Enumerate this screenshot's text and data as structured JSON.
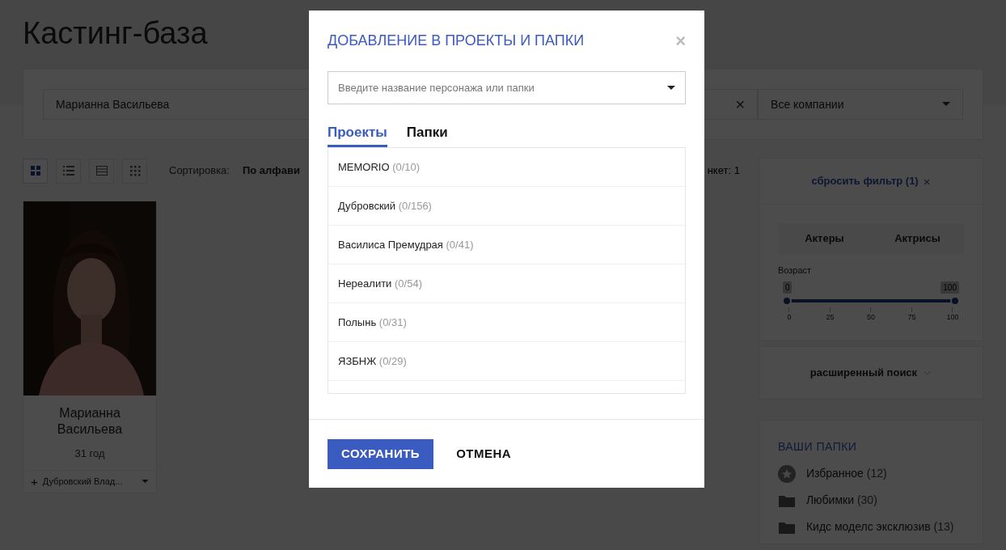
{
  "page": {
    "title": "Кастинг-база"
  },
  "search": {
    "value": "Марианна Васильева",
    "clear": "×",
    "company": "Все компании"
  },
  "toolbar": {
    "views": [
      {
        "kind": "grid",
        "selected": true
      },
      {
        "kind": "list",
        "selected": false
      },
      {
        "kind": "table",
        "selected": false
      },
      {
        "kind": "dots",
        "selected": false
      }
    ],
    "sort_label": "Сортировка:",
    "sort_value": "По алфави",
    "count": "нкет: 1"
  },
  "cards": [
    {
      "name": "Марианна Васильева",
      "age": "31 год",
      "plus": "+",
      "project": "Дубровский Влад..."
    }
  ],
  "filter": {
    "reset": "сбросить фильтр (1)",
    "reset_icon": "×",
    "genders": [
      {
        "label": "Актеры",
        "selected": false
      },
      {
        "label": "Актрисы",
        "selected": false
      }
    ],
    "age_label": "Возраст",
    "age_min": "0",
    "age_max": "100",
    "level": 1,
    "ticks": [
      "0",
      "25",
      "50",
      "75",
      "100"
    ],
    "advanced": "расширенный поиск"
  },
  "folders": {
    "title": "ВАШИ ПАПКИ",
    "items": [
      {
        "kind": "star",
        "name": "Избранное",
        "count": "(12)"
      },
      {
        "kind": "folder",
        "name": "Любимки",
        "count": "(30)"
      },
      {
        "kind": "folder",
        "name": "Кидс моделс эксклюзив",
        "count": "(13)"
      }
    ]
  },
  "dialog": {
    "title": "ДОБАВЛЕНИЕ В ПРОЕКТЫ И ПАПКИ",
    "close": "×",
    "placeholder": "Введите название персонажа или папки",
    "tabs": [
      {
        "label": "Проекты",
        "selected": true
      },
      {
        "label": "Папки",
        "selected": false
      }
    ],
    "items": [
      {
        "name": "MEMORIO",
        "count": "(0/10)"
      },
      {
        "name": "Дубровский",
        "count": "(0/156)"
      },
      {
        "name": "Василиса Премудрая",
        "count": "(0/41)"
      },
      {
        "name": "Нереалити",
        "count": "(0/54)"
      },
      {
        "name": "Полынь",
        "count": "(0/31)"
      },
      {
        "name": "ЯЗБНЖ",
        "count": "(0/29)"
      }
    ],
    "save": "СОХРАНИТЬ",
    "cancel": "ОТМЕНА"
  }
}
